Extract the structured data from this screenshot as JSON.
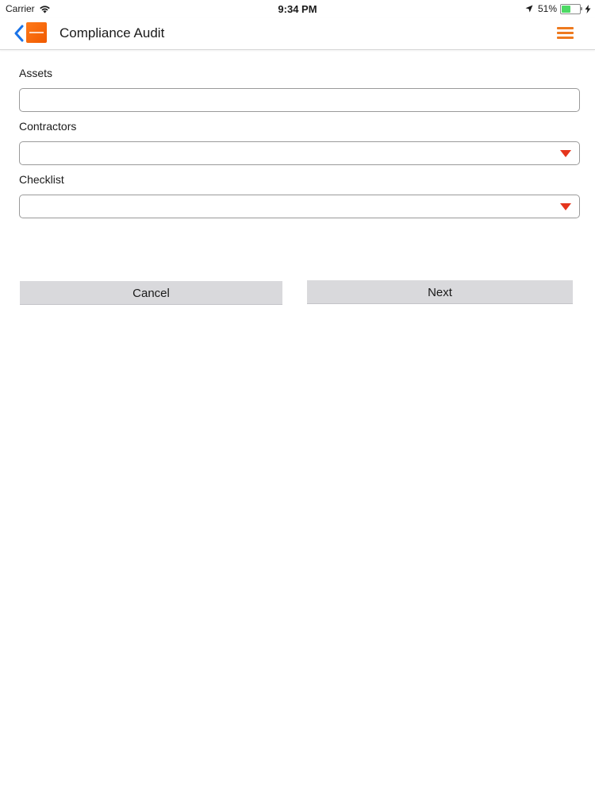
{
  "status_bar": {
    "carrier": "Carrier",
    "time": "9:34 PM",
    "battery_percent_label": "51%",
    "battery_level": 0.51,
    "wifi_icon": "wifi-icon",
    "location_icon": "location-arrow-icon",
    "charging_icon": "charging-bolt-icon"
  },
  "nav": {
    "title": "Compliance Audit",
    "back_icon": "chevron-left-icon",
    "menu_icon": "hamburger-menu-icon",
    "accent_color": "#ee7a1f",
    "back_color": "#1a73e8"
  },
  "form": {
    "assets": {
      "label": "Assets",
      "value": "",
      "placeholder": ""
    },
    "contractors": {
      "label": "Contractors",
      "value": ""
    },
    "checklist": {
      "label": "Checklist",
      "value": ""
    },
    "dropdown_caret_color": "#e5351d"
  },
  "buttons": {
    "cancel_label": "Cancel",
    "next_label": "Next"
  }
}
